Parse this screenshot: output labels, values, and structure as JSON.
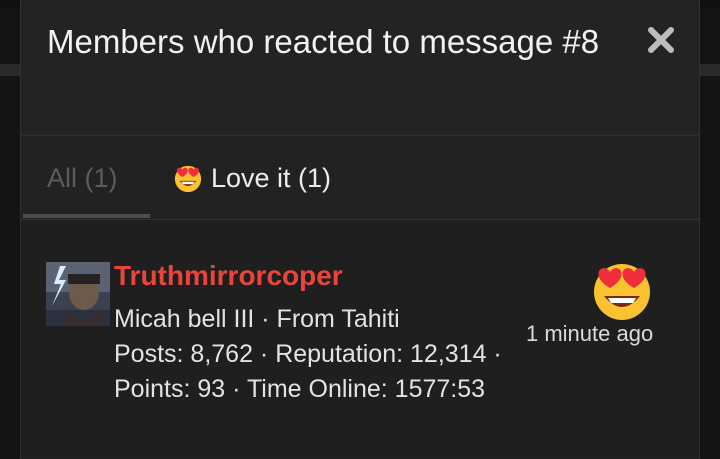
{
  "modal": {
    "title": "Members who reacted to message #8",
    "close_icon": "close-icon"
  },
  "tabs": [
    {
      "label": "All (1)",
      "active": true
    },
    {
      "label": "Love it (1)",
      "icon": "heart-eyes-emoji",
      "active": false
    }
  ],
  "member": {
    "username": "Truthmirrorcoper",
    "title_line": "Micah bell III · From Tahiti",
    "stats_line1": "Posts: 8,762 · Reputation: 12,314 ·",
    "stats_line2": "Points: 93 · Time Online: 1577:53",
    "time": "1 minute ago",
    "reaction_icon": "heart-eyes-emoji",
    "username_color": "#e8463a"
  }
}
